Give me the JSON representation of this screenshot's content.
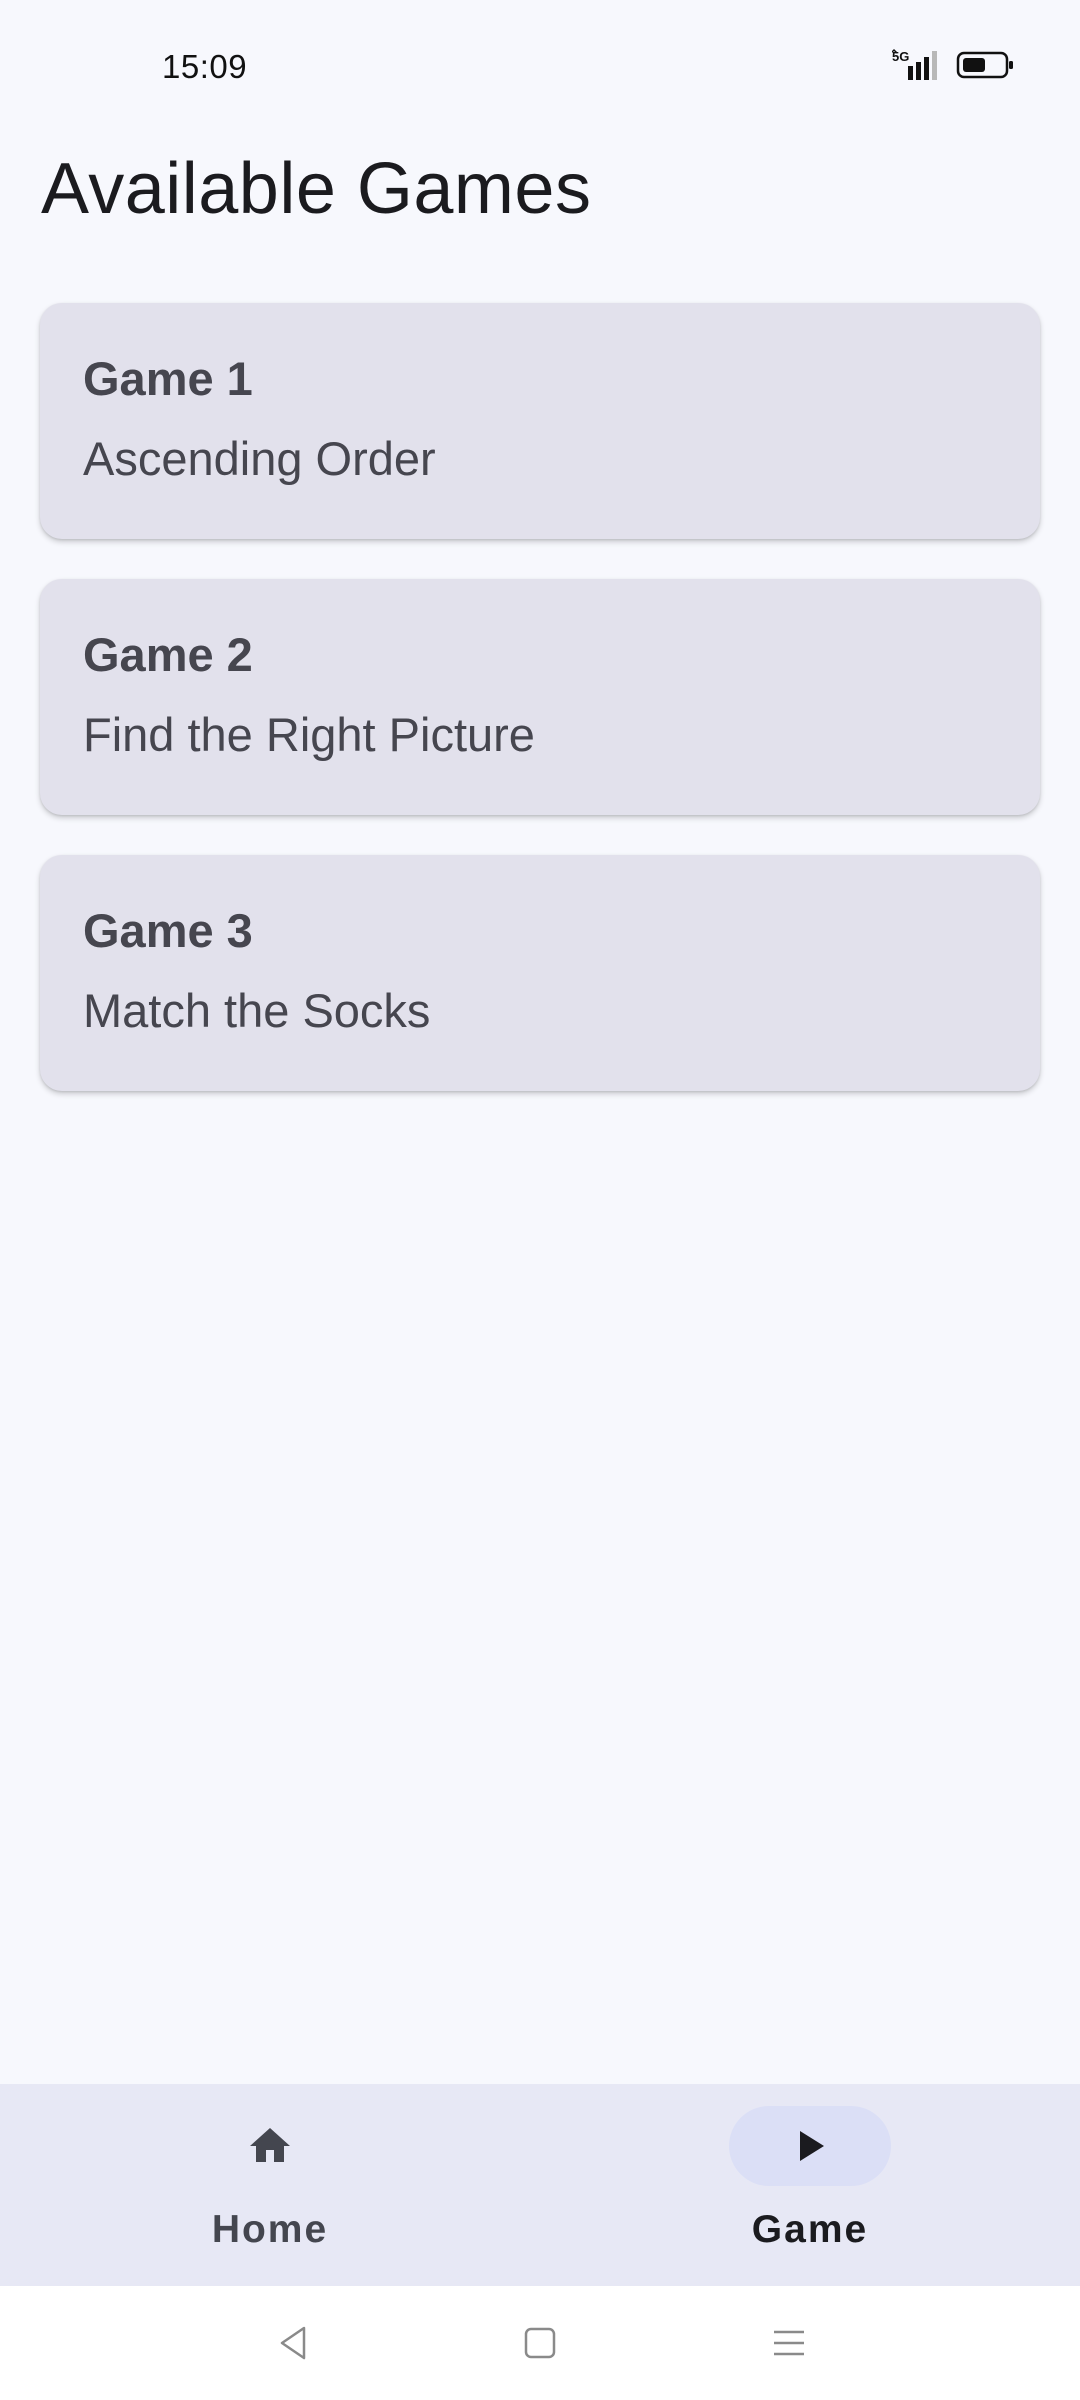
{
  "status_bar": {
    "time": "15:09",
    "network_label": "5G",
    "icons": [
      "signal-5g-icon",
      "battery-icon"
    ]
  },
  "page": {
    "title": "Available Games"
  },
  "games": [
    {
      "title": "Game 1",
      "subtitle": "Ascending Order"
    },
    {
      "title": "Game 2",
      "subtitle": "Find the Right Picture"
    },
    {
      "title": "Game 3",
      "subtitle": "Match the Socks"
    }
  ],
  "bottom_nav": {
    "items": [
      {
        "label": "Home",
        "icon": "home-icon",
        "selected": false
      },
      {
        "label": "Game",
        "icon": "play-icon",
        "selected": true
      }
    ]
  },
  "system_nav": {
    "buttons": [
      "back-icon",
      "home-square-icon",
      "recents-menu-icon"
    ]
  },
  "colors": {
    "background": "#f7f8fd",
    "card": "#e2e1ec",
    "nav_bar": "#e7e8f5",
    "nav_active_pill": "#dbdff6",
    "text_secondary": "#46464f"
  }
}
